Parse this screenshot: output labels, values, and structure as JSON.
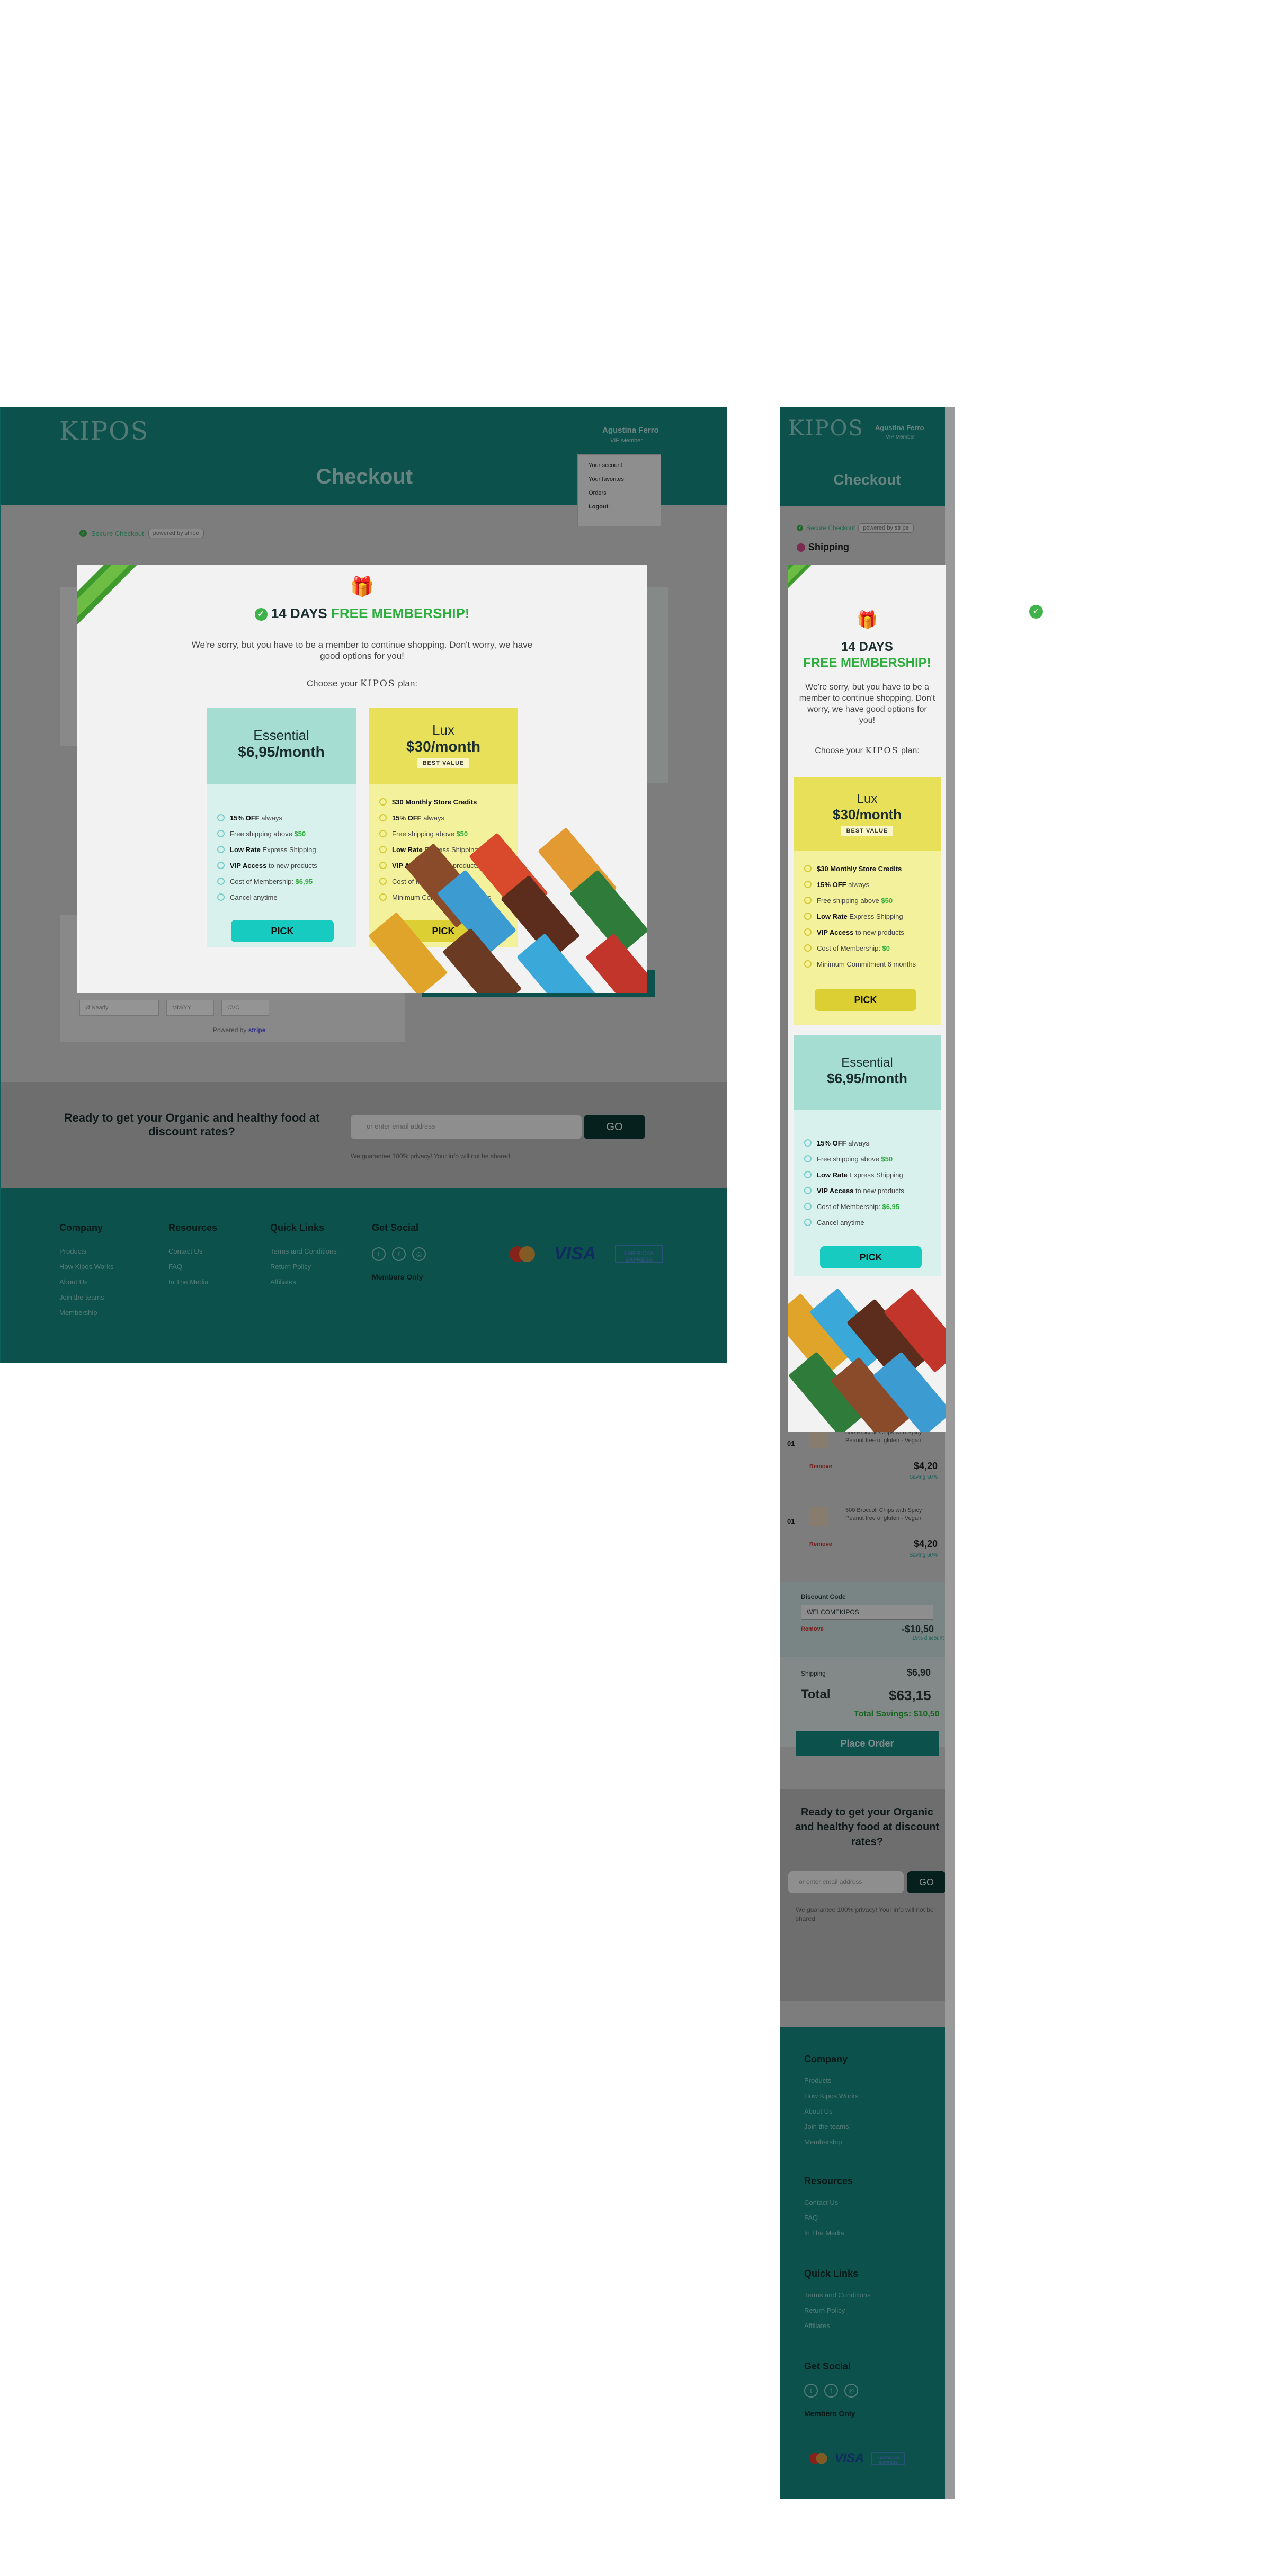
{
  "brand": {
    "logo": "KIPOS"
  },
  "account": {
    "name": "Agustina Ferro",
    "role": "VIP Member"
  },
  "account_menu": [
    "Your account",
    "Your favorites",
    "Orders",
    "Logout"
  ],
  "page": {
    "title": "Checkout"
  },
  "secure": {
    "label": "Secure Checkout",
    "powered": "powered by stripe"
  },
  "shipping": {
    "label": "Shipping"
  },
  "payment": {
    "placeholder_card": "Ø Nearly",
    "placeholder_date": "MM/YY",
    "placeholder_cvc": "CVC",
    "powered_by": "Powered by",
    "powered_brand": "stripe"
  },
  "modal": {
    "title_prefix": "14 DAYS",
    "title_highlight": "FREE MEMBERSHIP!",
    "subtitle": "We're sorry, but you have to be a member to continue shopping. Don't worry, we have good options for you!",
    "choose_prefix": "Choose your",
    "choose_brand": "KIPOS",
    "choose_suffix": "plan:",
    "essential": {
      "name": "Essential",
      "price": "$6,95/month",
      "features": [
        {
          "b": "15% OFF",
          "t": " always"
        },
        {
          "b": "",
          "t": "Free shipping above ",
          "g": "$50"
        },
        {
          "b": "Low Rate",
          "t": " Express Shipping"
        },
        {
          "b": "VIP Access",
          "t": " to new products"
        },
        {
          "b": "",
          "t": "Cost of Membership: ",
          "g": "$6,95"
        },
        {
          "b": "",
          "t": "Cancel anytime"
        }
      ],
      "pick": "PICK"
    },
    "lux": {
      "name": "Lux",
      "price": "$30/month",
      "badge": "BEST VALUE",
      "features": [
        {
          "b": "$30 Monthly Store Credits",
          "t": ""
        },
        {
          "b": "15% OFF",
          "t": " always"
        },
        {
          "b": "",
          "t": "Free shipping above ",
          "g": "$50"
        },
        {
          "b": "Low Rate",
          "t": " Express Shipping"
        },
        {
          "b": "VIP Access",
          "t": " to new products"
        },
        {
          "b": "",
          "t": "Cost of Membership: ",
          "g": "$0"
        },
        {
          "b": "",
          "t": "Minimum Commitment 6 months"
        }
      ],
      "pick": "PICK"
    }
  },
  "cart": {
    "items": [
      {
        "qty": "01",
        "name": "500 Broccoli Chips with Spicy Peanut free of gluten - Vegan",
        "remove": "Remove",
        "price": "$4,20",
        "saving": "Saving 50%"
      },
      {
        "qty": "01",
        "name": "500 Broccoli Chips with Spicy Peanut free of gluten - Vegan",
        "remove": "Remove",
        "price": "$4,20",
        "saving": "Saving 50%"
      }
    ],
    "discount_label": "Discount Code",
    "discount_code": "WELCOMEKIPOS",
    "discount_remove": "Remove",
    "discount_value": "-$10,50",
    "discount_note": "15% discount",
    "shipping_label": "Shipping",
    "shipping_value": "$6,90",
    "total_label": "Total",
    "total_value": "$63,15",
    "total_savings": "Total Savings: $10,50",
    "place_order": "Place Order"
  },
  "newsletter": {
    "heading": "Ready to get your Organic and healthy food at discount rates?",
    "placeholder": "or enter email address",
    "go": "GO",
    "note": "We guarantee 100% privacy! Your info will not be shared."
  },
  "footer": {
    "company": {
      "title": "Company",
      "links": [
        "Products",
        "How Kipos Works",
        "About Us",
        "Join the teams",
        "Membership"
      ]
    },
    "resources": {
      "title": "Resources",
      "links": [
        "Contact Us",
        "FAQ",
        "In The Media"
      ]
    },
    "quick": {
      "title": "Quick Links",
      "links": [
        "Terms and Conditions",
        "Return Policy",
        "Affiliates"
      ]
    },
    "social": {
      "title": "Get Social",
      "members": "Members Only"
    },
    "cards": {
      "visa": "VISA",
      "amex": "AMERICAN EXPRESS"
    }
  },
  "colors": {
    "teal": "#178c85",
    "green": "#2cae3c",
    "essential": "#a6ddd3",
    "lux": "#e9e05a"
  }
}
